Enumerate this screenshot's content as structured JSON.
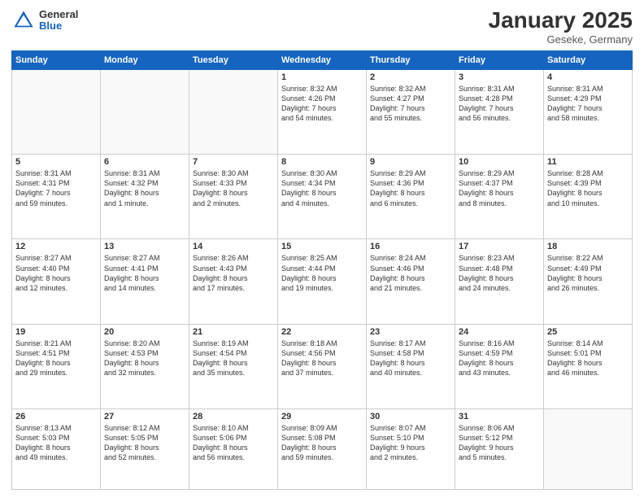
{
  "header": {
    "logo_general": "General",
    "logo_blue": "Blue",
    "title": "January 2025",
    "subtitle": "Geseke, Germany"
  },
  "days_of_week": [
    "Sunday",
    "Monday",
    "Tuesday",
    "Wednesday",
    "Thursday",
    "Friday",
    "Saturday"
  ],
  "weeks": [
    [
      {
        "day": "",
        "text": ""
      },
      {
        "day": "",
        "text": ""
      },
      {
        "day": "",
        "text": ""
      },
      {
        "day": "1",
        "text": "Sunrise: 8:32 AM\nSunset: 4:26 PM\nDaylight: 7 hours\nand 54 minutes."
      },
      {
        "day": "2",
        "text": "Sunrise: 8:32 AM\nSunset: 4:27 PM\nDaylight: 7 hours\nand 55 minutes."
      },
      {
        "day": "3",
        "text": "Sunrise: 8:31 AM\nSunset: 4:28 PM\nDaylight: 7 hours\nand 56 minutes."
      },
      {
        "day": "4",
        "text": "Sunrise: 8:31 AM\nSunset: 4:29 PM\nDaylight: 7 hours\nand 58 minutes."
      }
    ],
    [
      {
        "day": "5",
        "text": "Sunrise: 8:31 AM\nSunset: 4:31 PM\nDaylight: 7 hours\nand 59 minutes."
      },
      {
        "day": "6",
        "text": "Sunrise: 8:31 AM\nSunset: 4:32 PM\nDaylight: 8 hours\nand 1 minute."
      },
      {
        "day": "7",
        "text": "Sunrise: 8:30 AM\nSunset: 4:33 PM\nDaylight: 8 hours\nand 2 minutes."
      },
      {
        "day": "8",
        "text": "Sunrise: 8:30 AM\nSunset: 4:34 PM\nDaylight: 8 hours\nand 4 minutes."
      },
      {
        "day": "9",
        "text": "Sunrise: 8:29 AM\nSunset: 4:36 PM\nDaylight: 8 hours\nand 6 minutes."
      },
      {
        "day": "10",
        "text": "Sunrise: 8:29 AM\nSunset: 4:37 PM\nDaylight: 8 hours\nand 8 minutes."
      },
      {
        "day": "11",
        "text": "Sunrise: 8:28 AM\nSunset: 4:39 PM\nDaylight: 8 hours\nand 10 minutes."
      }
    ],
    [
      {
        "day": "12",
        "text": "Sunrise: 8:27 AM\nSunset: 4:40 PM\nDaylight: 8 hours\nand 12 minutes."
      },
      {
        "day": "13",
        "text": "Sunrise: 8:27 AM\nSunset: 4:41 PM\nDaylight: 8 hours\nand 14 minutes."
      },
      {
        "day": "14",
        "text": "Sunrise: 8:26 AM\nSunset: 4:43 PM\nDaylight: 8 hours\nand 17 minutes."
      },
      {
        "day": "15",
        "text": "Sunrise: 8:25 AM\nSunset: 4:44 PM\nDaylight: 8 hours\nand 19 minutes."
      },
      {
        "day": "16",
        "text": "Sunrise: 8:24 AM\nSunset: 4:46 PM\nDaylight: 8 hours\nand 21 minutes."
      },
      {
        "day": "17",
        "text": "Sunrise: 8:23 AM\nSunset: 4:48 PM\nDaylight: 8 hours\nand 24 minutes."
      },
      {
        "day": "18",
        "text": "Sunrise: 8:22 AM\nSunset: 4:49 PM\nDaylight: 8 hours\nand 26 minutes."
      }
    ],
    [
      {
        "day": "19",
        "text": "Sunrise: 8:21 AM\nSunset: 4:51 PM\nDaylight: 8 hours\nand 29 minutes."
      },
      {
        "day": "20",
        "text": "Sunrise: 8:20 AM\nSunset: 4:53 PM\nDaylight: 8 hours\nand 32 minutes."
      },
      {
        "day": "21",
        "text": "Sunrise: 8:19 AM\nSunset: 4:54 PM\nDaylight: 8 hours\nand 35 minutes."
      },
      {
        "day": "22",
        "text": "Sunrise: 8:18 AM\nSunset: 4:56 PM\nDaylight: 8 hours\nand 37 minutes."
      },
      {
        "day": "23",
        "text": "Sunrise: 8:17 AM\nSunset: 4:58 PM\nDaylight: 8 hours\nand 40 minutes."
      },
      {
        "day": "24",
        "text": "Sunrise: 8:16 AM\nSunset: 4:59 PM\nDaylight: 8 hours\nand 43 minutes."
      },
      {
        "day": "25",
        "text": "Sunrise: 8:14 AM\nSunset: 5:01 PM\nDaylight: 8 hours\nand 46 minutes."
      }
    ],
    [
      {
        "day": "26",
        "text": "Sunrise: 8:13 AM\nSunset: 5:03 PM\nDaylight: 8 hours\nand 49 minutes."
      },
      {
        "day": "27",
        "text": "Sunrise: 8:12 AM\nSunset: 5:05 PM\nDaylight: 8 hours\nand 52 minutes."
      },
      {
        "day": "28",
        "text": "Sunrise: 8:10 AM\nSunset: 5:06 PM\nDaylight: 8 hours\nand 56 minutes."
      },
      {
        "day": "29",
        "text": "Sunrise: 8:09 AM\nSunset: 5:08 PM\nDaylight: 8 hours\nand 59 minutes."
      },
      {
        "day": "30",
        "text": "Sunrise: 8:07 AM\nSunset: 5:10 PM\nDaylight: 9 hours\nand 2 minutes."
      },
      {
        "day": "31",
        "text": "Sunrise: 8:06 AM\nSunset: 5:12 PM\nDaylight: 9 hours\nand 5 minutes."
      },
      {
        "day": "",
        "text": ""
      }
    ]
  ]
}
